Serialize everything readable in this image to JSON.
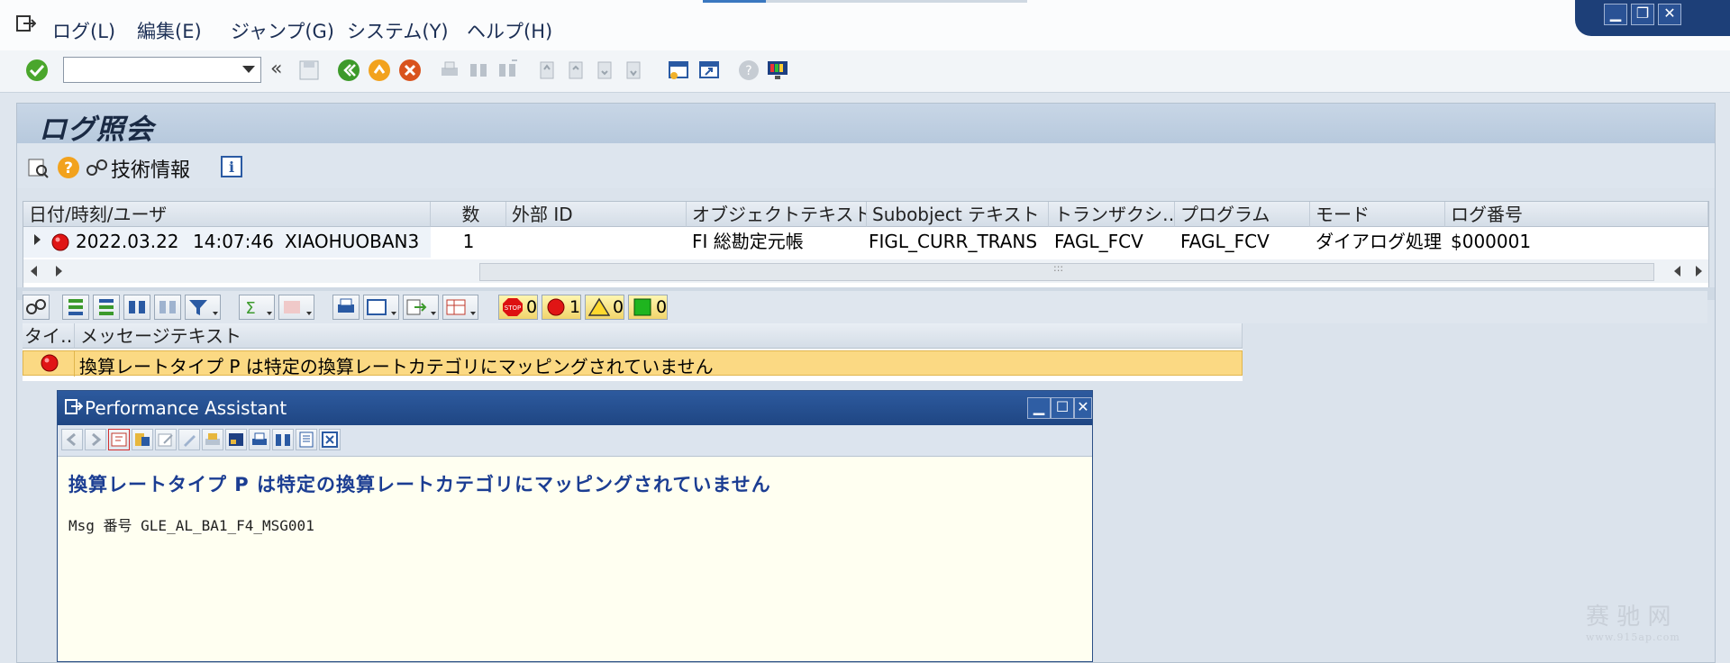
{
  "menubar": {
    "items": [
      "ログ(L)",
      "編集(E)",
      "ジャンプ(G)",
      "システム(Y)",
      "ヘルプ(H)"
    ]
  },
  "toolbar": {
    "command_value": "",
    "back_label": "«"
  },
  "page": {
    "title": "ログ照会",
    "tech_info_label": "技術情報"
  },
  "log_table": {
    "headers": [
      "日付/時刻/ユーザ",
      "数",
      "外部 ID",
      "オブジェクトテキスト",
      "Subobject テキスト",
      "トランザクシ…",
      "プログラム",
      "モード",
      "ログ番号"
    ],
    "row": {
      "date": "2022.03.22",
      "time": "14:07:46",
      "user": "XIAOHUOBAN3",
      "count": "1",
      "external_id": "",
      "object_text": "FI 総勘定元帳",
      "subobject_text": "FIGL_CURR_TRANS",
      "transaction": "FAGL_FCV",
      "program": "FAGL_FCV",
      "mode": "ダイアログ処理",
      "log_number": "$000001"
    },
    "scroll_grip": ":::"
  },
  "alv": {
    "counters": [
      {
        "kind": "stop",
        "value": "0"
      },
      {
        "kind": "error",
        "value": "1"
      },
      {
        "kind": "warning",
        "value": "0"
      },
      {
        "kind": "success",
        "value": "0"
      }
    ],
    "headers": [
      "タイ…",
      "メッセージテキスト"
    ],
    "message": "換算レートタイプ P は特定の換算レートカテゴリにマッピングされていません"
  },
  "performance_assistant": {
    "title": "Performance Assistant",
    "heading": "換算レートタイプ P は特定の換算レートカテゴリにマッピングされていません",
    "msg_no": "Msg 番号 GLE_AL_BA1_F4_MSG001"
  },
  "colors": {
    "accent": "#1f4683",
    "highlight_row": "#fbd983",
    "error_red": "#e01515",
    "heading_blue": "#1b3d92"
  },
  "watermark": {
    "main": "赛 驰 网",
    "sub": "www.915ap.com"
  }
}
